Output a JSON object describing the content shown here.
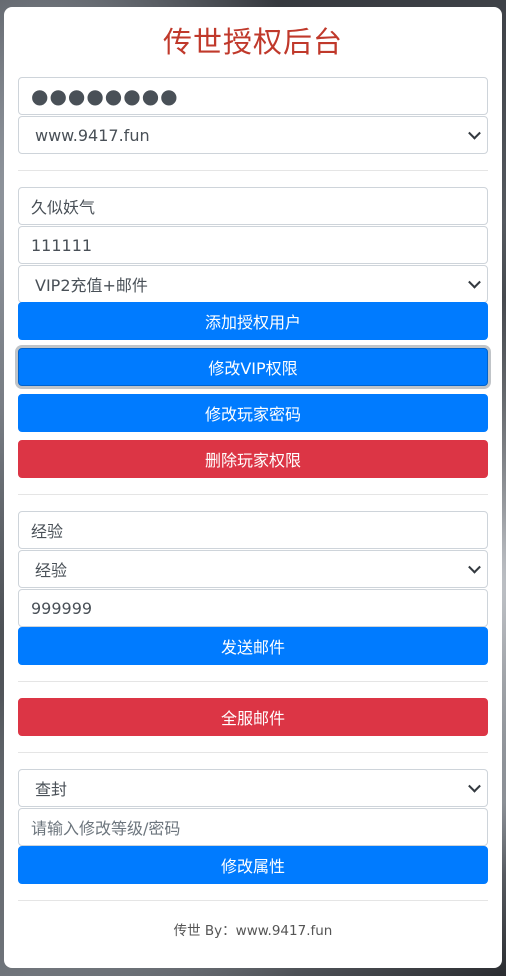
{
  "title": "传世授权后台",
  "login": {
    "password_mask": "●●●●●●●●",
    "server_select": "www.9417.fun"
  },
  "auth": {
    "username": "久似妖气",
    "password": "111111",
    "vip_select": "VIP2充值+邮件",
    "add_button": "添加授权用户",
    "modify_vip_button": "修改VIP权限",
    "modify_password_button": "修改玩家密码",
    "delete_button": "删除玩家权限"
  },
  "mail": {
    "item_input": "经验",
    "item_select": "经验",
    "amount": "999999",
    "send_button": "发送邮件"
  },
  "server_mail": {
    "button": "全服邮件"
  },
  "attribute": {
    "type_select": "查封",
    "input_placeholder": "请输入修改等级/密码",
    "modify_button": "修改属性"
  },
  "footer": "传世 By：www.9417.fun",
  "colors": {
    "primary": "#007bff",
    "danger": "#dc3545",
    "title": "#c0392b"
  }
}
